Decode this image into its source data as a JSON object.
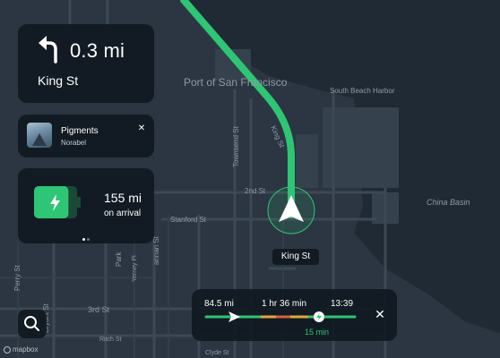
{
  "map": {
    "labels": {
      "port_of_san_francisco": "Port of San Francisco",
      "south_beach_harbor": "South Beach Harbor",
      "china_basin": "China Basin",
      "king_st": "King St",
      "townsend_st": "Townsend St",
      "second_st": "2nd St",
      "stanford_st": "Stanford St",
      "brannan_st": "annan St",
      "park": "Park",
      "yerney_pl": "Yerney Pl",
      "perry_st": "Perry St",
      "bryant_st": "Bryant St",
      "third_st": "3rd St",
      "ritch_st": "Ritch St",
      "clyde_st": "Clyde St"
    },
    "route_color": "#2ec574",
    "water_color": "#1f2a35",
    "land_color": "#2b3642"
  },
  "navigation": {
    "turn_icon": "turn-left-arrow-icon",
    "distance": "0.3 mi",
    "street": "King St"
  },
  "media": {
    "title": "Pigments",
    "artist": "Norabel",
    "close_icon": "close-icon",
    "close_label": "✕"
  },
  "battery": {
    "icon": "battery-charging-icon",
    "range": "155 mi",
    "caption": "on arrival",
    "color": "#2ec574",
    "level": 0.8
  },
  "pagination": {
    "count": 2,
    "active_index": 0
  },
  "search": {
    "icon": "search-icon"
  },
  "attribution": {
    "logo_text": "mapbox"
  },
  "current_position": {
    "street_label": "King St"
  },
  "trip": {
    "distance_remaining": "84.5 mi",
    "duration": "1 hr 36 min",
    "arrival_time": "13:39",
    "charge_time": "15 min",
    "close_label": "✕",
    "progress_fraction": 0.0
  }
}
